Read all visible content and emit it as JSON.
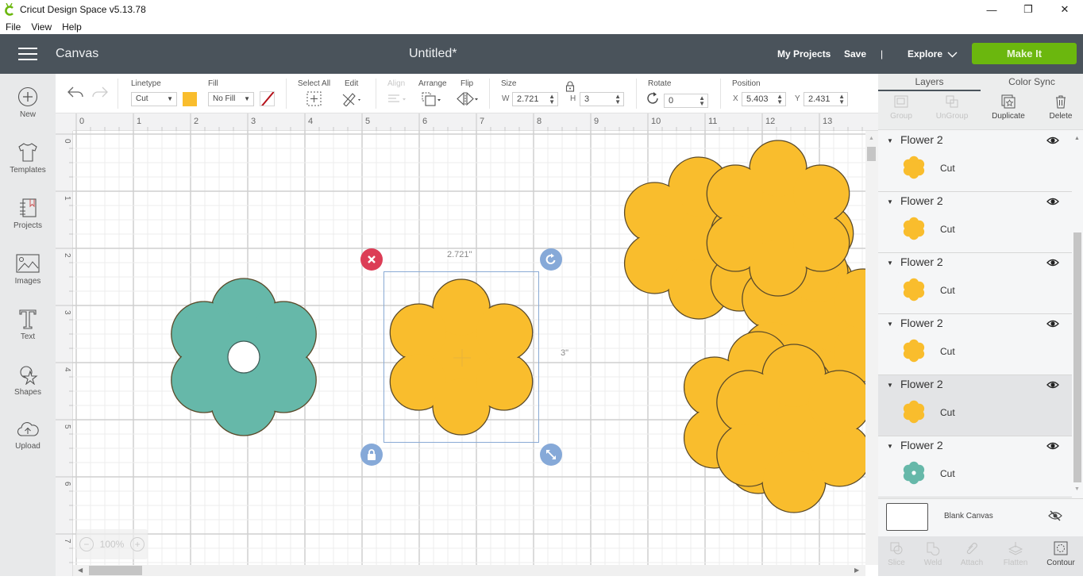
{
  "window": {
    "title": "Cricut Design Space  v5.13.78",
    "controls": {
      "minimize": "—",
      "maximize": "❐",
      "close": "✕"
    }
  },
  "menu": [
    "File",
    "View",
    "Help"
  ],
  "header": {
    "section": "Canvas",
    "doc_title": "Untitled*",
    "my_projects": "My Projects",
    "save": "Save",
    "divider": "|",
    "explore": "Explore",
    "make_it": "Make It",
    "make_it_color": "#6bb70e"
  },
  "sidebar": {
    "items": [
      {
        "label": "New",
        "icon": "plus-circle-icon"
      },
      {
        "label": "Templates",
        "icon": "tshirt-icon"
      },
      {
        "label": "Projects",
        "icon": "notebook-icon"
      },
      {
        "label": "Images",
        "icon": "image-icon"
      },
      {
        "label": "Text",
        "icon": "text-icon"
      },
      {
        "label": "Shapes",
        "icon": "shapes-icon"
      },
      {
        "label": "Upload",
        "icon": "cloud-upload-icon"
      }
    ]
  },
  "toolbar": {
    "linetype_label": "Linetype",
    "linetype_value": "Cut",
    "linetype_color": "#f9bd2d",
    "fill_label": "Fill",
    "fill_value": "No Fill",
    "select_all_label": "Select All",
    "edit_label": "Edit",
    "align_label": "Align",
    "arrange_label": "Arrange",
    "flip_label": "Flip",
    "size_label": "Size",
    "w_label": "W",
    "w_value": "2.721",
    "h_label": "H",
    "h_value": "3",
    "rotate_label": "Rotate",
    "rotate_value": "0",
    "position_label": "Position",
    "x_label": "X",
    "x_value": "5.403",
    "y_label": "Y",
    "y_value": "2.431"
  },
  "rulers": {
    "top": [
      "0",
      "1",
      "2",
      "3",
      "4",
      "5",
      "6",
      "7",
      "8",
      "9",
      "10",
      "11",
      "12",
      "13"
    ],
    "left": [
      "0",
      "1",
      "2",
      "3",
      "4",
      "5",
      "6",
      "7"
    ]
  },
  "canvas": {
    "selection_width_label": "2.721\"",
    "selection_height_label": "3\"",
    "zoom_level": "100%",
    "colors": {
      "yellow": "#f9bd2d",
      "teal": "#66b8a9",
      "selection": "#8aaad4",
      "delete_handle": "#dc3d56",
      "handle": "#86a9d8"
    }
  },
  "panel": {
    "tabs": [
      "Layers",
      "Color Sync"
    ],
    "actions": [
      "Group",
      "UnGroup",
      "Duplicate",
      "Delete"
    ],
    "layers": [
      {
        "name": "Flower 2",
        "op": "Cut",
        "color": "#f9bd2d",
        "selected": false
      },
      {
        "name": "Flower 2",
        "op": "Cut",
        "color": "#f9bd2d",
        "selected": false
      },
      {
        "name": "Flower 2",
        "op": "Cut",
        "color": "#f9bd2d",
        "selected": false
      },
      {
        "name": "Flower 2",
        "op": "Cut",
        "color": "#f9bd2d",
        "selected": false
      },
      {
        "name": "Flower 2",
        "op": "Cut",
        "color": "#f9bd2d",
        "selected": true
      },
      {
        "name": "Flower 2",
        "op": "Cut",
        "color": "#66b8a9",
        "selected": false
      }
    ],
    "blank_canvas": "Blank Canvas",
    "bottom_actions": [
      "Slice",
      "Weld",
      "Attach",
      "Flatten",
      "Contour"
    ]
  }
}
